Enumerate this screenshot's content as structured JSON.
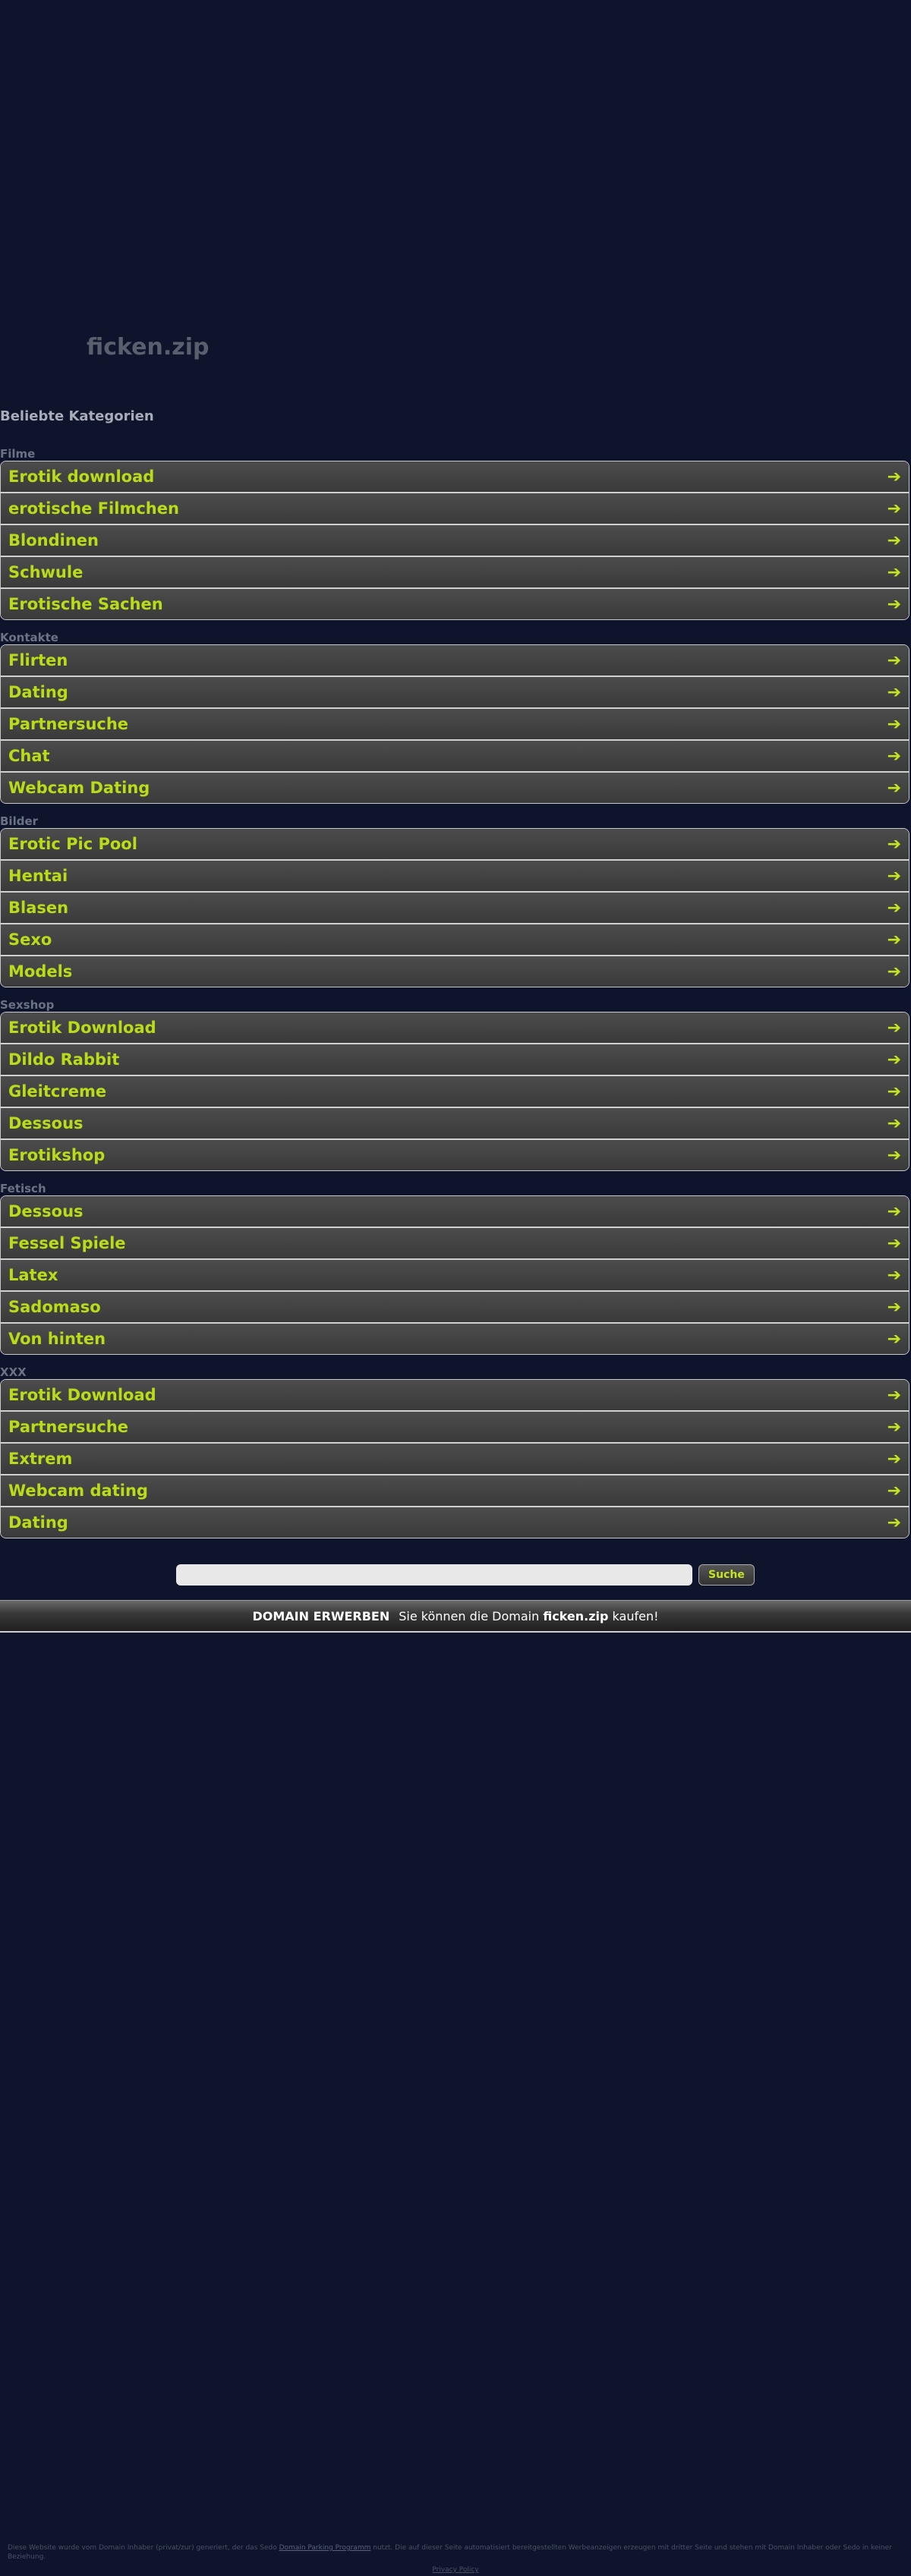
{
  "domain": "ficken.zip",
  "heading": "Beliebte Kategorien",
  "categories": [
    {
      "title": "Filme",
      "items": [
        "Erotik download",
        "erotische Filmchen",
        "Blondinen",
        "Schwule",
        "Erotische Sachen"
      ]
    },
    {
      "title": "Kontakte",
      "items": [
        "Flirten",
        "Dating",
        "Partnersuche",
        "Chat",
        "Webcam Dating"
      ]
    },
    {
      "title": "Bilder",
      "items": [
        "Erotic Pic Pool",
        "Hentai",
        "Blasen",
        "Sexo",
        "Models"
      ]
    },
    {
      "title": "Sexshop",
      "items": [
        "Erotik Download",
        "Dildo Rabbit",
        "Gleitcreme",
        "Dessous",
        "Erotikshop"
      ]
    },
    {
      "title": "Fetisch",
      "items": [
        "Dessous",
        "Fessel Spiele",
        "Latex",
        "Sadomaso",
        "Von hinten"
      ]
    },
    {
      "title": "XXX",
      "items": [
        "Erotik Download",
        "Partnersuche",
        "Extrem",
        "Webcam dating",
        "Dating"
      ]
    }
  ],
  "arrow_icon": "arrow-right-icon",
  "search": {
    "placeholder": "",
    "button": "Suche"
  },
  "buybar": {
    "cta": "DOMAIN ERWERBEN",
    "text_before": "Sie können die Domain",
    "domain": "ficken.zip",
    "text_after": "kaufen!"
  },
  "footer": {
    "disclaimer_before": "Diese Website wurde vom Domain Inhaber (privat/zur) generiert, der das Sedo",
    "disclaimer_link": "Domain Parking Programm",
    "disclaimer_after": "nutzt. Die auf dieser Seite automatisiert bereitgestellten Werbeanzeigen erzeugen mit dritter Seite und stehen mit Domain Inhaber oder Sedo in keiner Beziehung.",
    "privacy": "Privacy Policy"
  },
  "colors": {
    "background": "#0d142c",
    "accent": "#b8dd18",
    "item_bg": "#444444"
  }
}
